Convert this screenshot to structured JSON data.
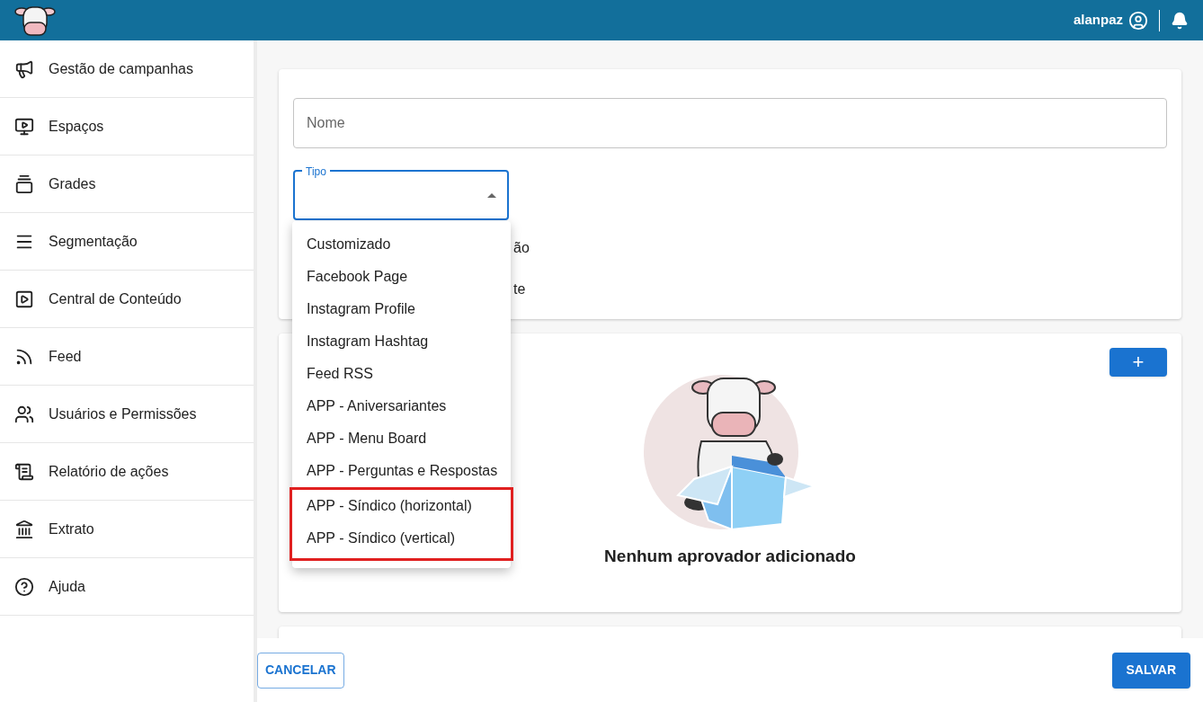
{
  "header": {
    "username": "alanpaz"
  },
  "sidebar": {
    "items": [
      {
        "label": "Gestão de campanhas",
        "kind": "megaphone"
      },
      {
        "label": "Espaços",
        "kind": "tv"
      },
      {
        "label": "Grades",
        "kind": "carousel"
      },
      {
        "label": "Segmentação",
        "kind": "lines"
      },
      {
        "label": "Central de Conteúdo",
        "kind": "library"
      },
      {
        "label": "Feed",
        "kind": "rss"
      },
      {
        "label": "Usuários e Permissões",
        "kind": "people"
      },
      {
        "label": "Relatório de ações",
        "kind": "scroll"
      },
      {
        "label": "Extrato",
        "kind": "bank"
      },
      {
        "label": "Ajuda",
        "kind": "help"
      }
    ]
  },
  "form": {
    "name_field": {
      "placeholder": "Nome"
    },
    "type_field": {
      "label": "Tipo",
      "expanded": true
    },
    "hidden_options": [
      "ão",
      "te"
    ],
    "menu": [
      {
        "label": "Customizado",
        "highlighted": false
      },
      {
        "label": "Facebook Page",
        "highlighted": false
      },
      {
        "label": "Instagram Profile",
        "highlighted": false
      },
      {
        "label": "Instagram Hashtag",
        "highlighted": false
      },
      {
        "label": "Feed RSS",
        "highlighted": false
      },
      {
        "label": "APP - Aniversariantes",
        "highlighted": false
      },
      {
        "label": "APP - Menu Board",
        "highlighted": false
      },
      {
        "label": "APP - Perguntas e Respostas",
        "highlighted": false
      },
      {
        "label": "APP - Síndico (horizontal)",
        "highlighted": true
      },
      {
        "label": "APP - Síndico (vertical)",
        "highlighted": true
      }
    ]
  },
  "approvers": {
    "add_button": "+",
    "empty_message": "Nenhum aprovador adicionado"
  },
  "footer": {
    "cancel": "CANCELAR",
    "save": "SALVAR"
  }
}
